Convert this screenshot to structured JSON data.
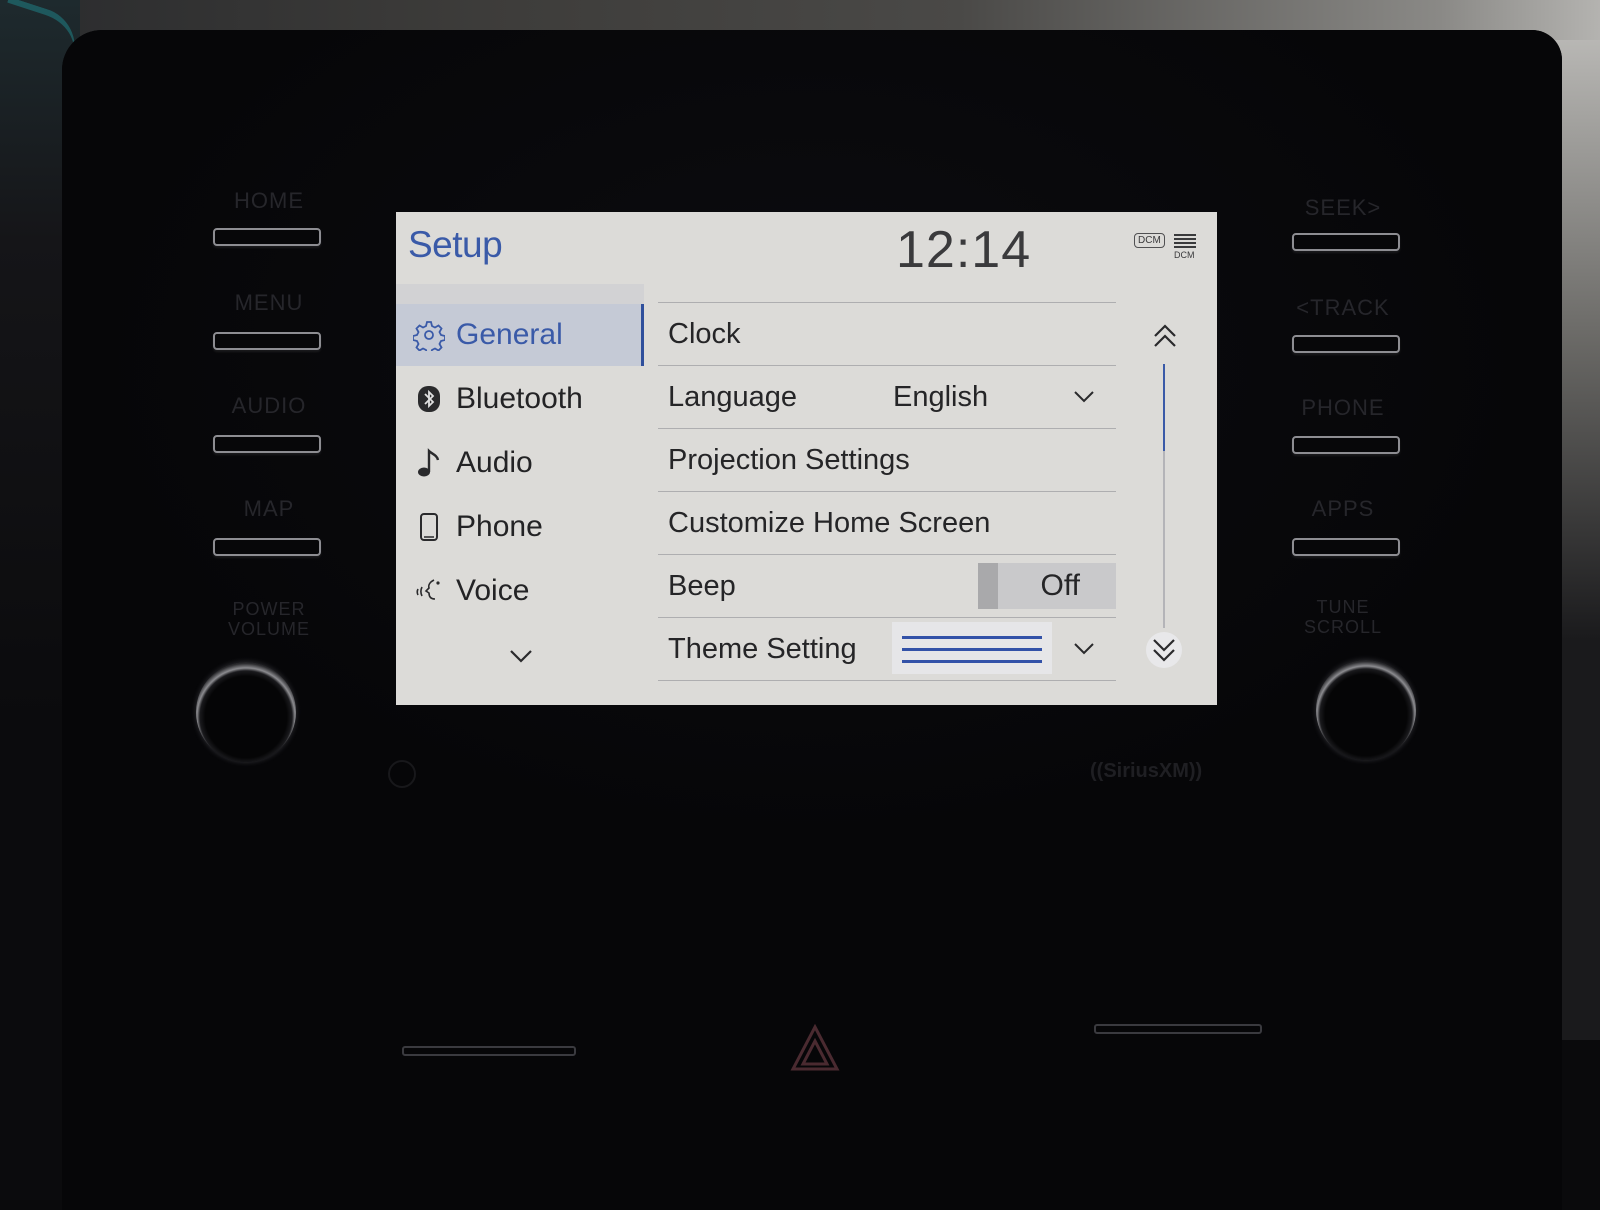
{
  "hardware": {
    "left_buttons": [
      "HOME",
      "MENU",
      "AUDIO",
      "MAP"
    ],
    "left_knob_label": [
      "POWER",
      "VOLUME"
    ],
    "right_buttons": [
      "SEEK>",
      "<TRACK",
      "PHONE",
      "APPS"
    ],
    "right_knob_label": [
      "TUNE",
      "SCROLL"
    ],
    "brand_mark": "((SiriusXM))"
  },
  "screen": {
    "header": {
      "title": "Setup",
      "clock": "12:14",
      "status_badge": "DCM",
      "signal_label": "DCM"
    },
    "sidebar": {
      "items": [
        {
          "label": "General",
          "icon": "gear-icon",
          "active": true
        },
        {
          "label": "Bluetooth",
          "icon": "bluetooth-icon",
          "active": false
        },
        {
          "label": "Audio",
          "icon": "music-note-icon",
          "active": false
        },
        {
          "label": "Phone",
          "icon": "phone-icon",
          "active": false
        },
        {
          "label": "Voice",
          "icon": "voice-icon",
          "active": false
        }
      ],
      "more_icon": "chevron-down-icon"
    },
    "settings": {
      "rows": [
        {
          "label": "Clock"
        },
        {
          "label": "Language",
          "value": "English",
          "control": "dropdown"
        },
        {
          "label": "Projection Settings"
        },
        {
          "label": "Customize Home Screen"
        },
        {
          "label": "Beep",
          "value": "Off",
          "control": "toggle"
        },
        {
          "label": "Theme Setting",
          "control": "dropdown",
          "swatch": "theme-lines"
        }
      ]
    },
    "scrollbar": {
      "position_fraction": 0.0,
      "visible_fraction": 0.33
    },
    "colors": {
      "accent": "#3a5aa8",
      "background": "#dcdbd8",
      "active_item_bg": "#c5cad6",
      "text": "#252527"
    }
  }
}
